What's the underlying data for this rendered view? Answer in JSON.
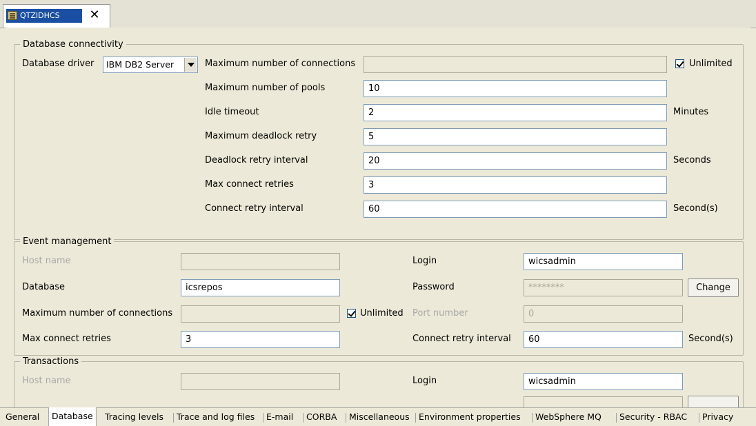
{
  "editor_tab": {
    "title": "QTZIDHCS",
    "close": "✕"
  },
  "database_connectivity": {
    "legend": "Database connectivity",
    "driver_label": "Database driver",
    "driver_value": "IBM DB2 Server",
    "max_connections_label": "Maximum number of connections",
    "max_connections_value": "",
    "unlimited_label": "Unlimited",
    "unlimited_checked": true,
    "max_pools_label": "Maximum number of pools",
    "max_pools_value": "10",
    "idle_timeout_label": "Idle timeout",
    "idle_timeout_value": "2",
    "idle_timeout_unit": "Minutes",
    "deadlock_retry_label": "Maximum deadlock retry",
    "deadlock_retry_value": "5",
    "deadlock_interval_label": "Deadlock retry interval",
    "deadlock_interval_value": "20",
    "deadlock_interval_unit": "Seconds",
    "max_connect_retries_label": "Max connect retries",
    "max_connect_retries_value": "3",
    "connect_retry_interval_label": "Connect retry interval",
    "connect_retry_interval_value": "60",
    "connect_retry_interval_unit": "Second(s)"
  },
  "event_management": {
    "legend": "Event management",
    "host_label": "Host name",
    "host_value": "",
    "database_label": "Database",
    "database_value": "icsrepos",
    "max_connections_label": "Maximum number of connections",
    "max_connections_value": "",
    "unlimited_label": "Unlimited",
    "unlimited_checked": true,
    "max_connect_retries_label": "Max connect retries",
    "max_connect_retries_value": "3",
    "login_label": "Login",
    "login_value": "wicsadmin",
    "password_label": "Password",
    "password_value": "********",
    "change_label": "Change",
    "port_label": "Port number",
    "port_value": "0",
    "connect_retry_interval_label": "Connect retry interval",
    "connect_retry_interval_value": "60",
    "connect_retry_interval_unit": "Second(s)"
  },
  "transactions": {
    "legend": "Transactions",
    "host_label": "Host name",
    "host_value": "",
    "login_label": "Login",
    "login_value": "wicsadmin"
  },
  "bottom_tabs": [
    "General",
    "Database",
    "Tracing levels",
    "Trace and log files",
    "E-mail",
    "CORBA",
    "Miscellaneous",
    "Environment properties",
    "WebSphere MQ",
    "Security - RBAC",
    "Privacy"
  ],
  "active_bottom_tab": "Database"
}
